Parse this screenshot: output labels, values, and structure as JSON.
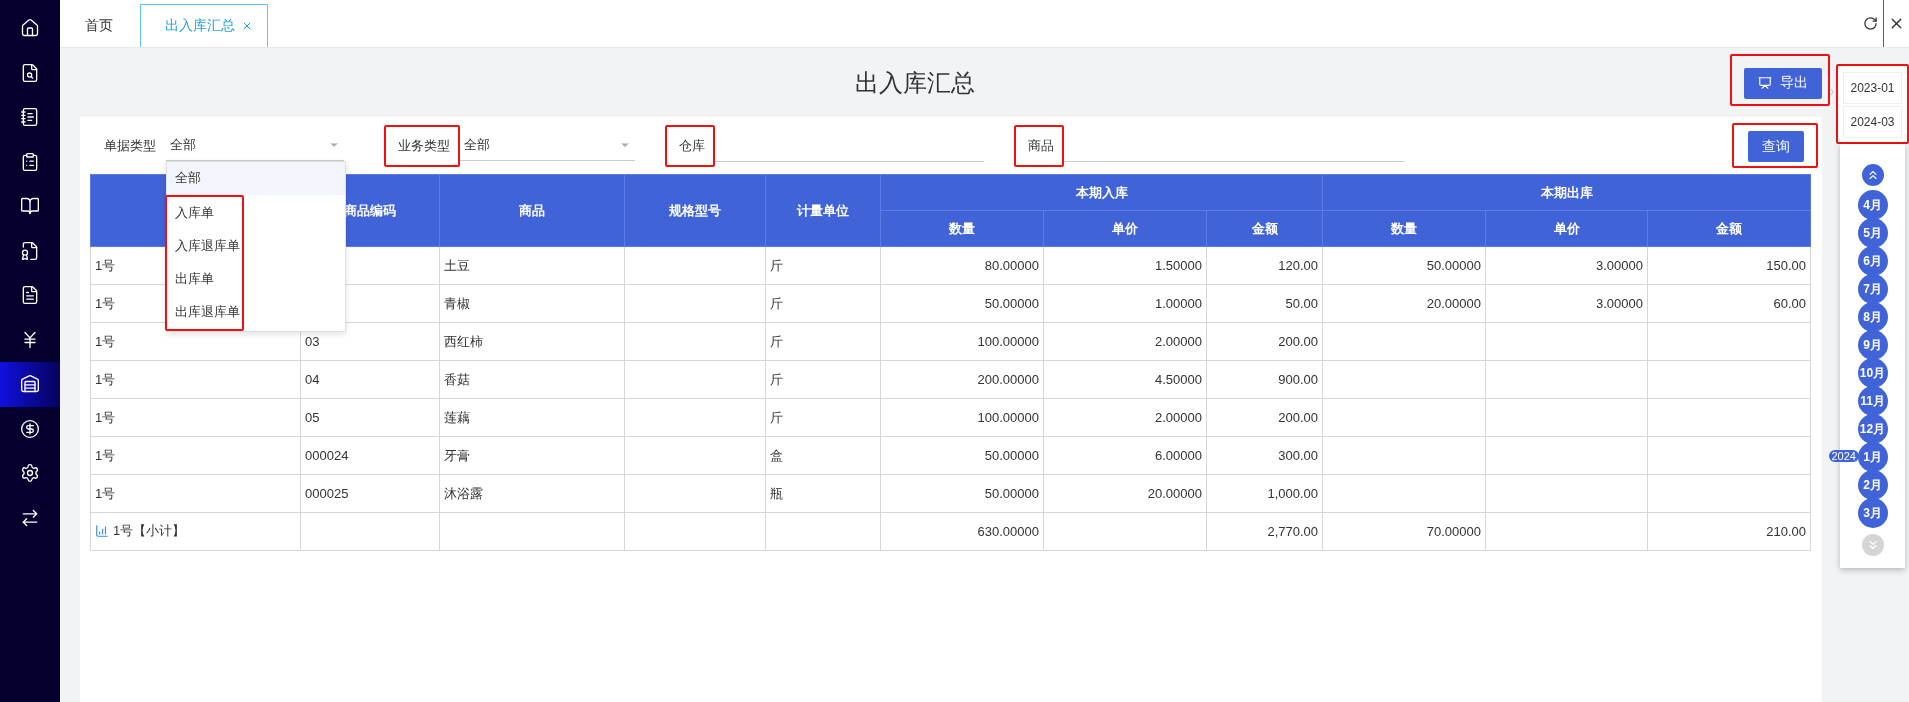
{
  "sidebar": {
    "items": [
      {
        "selected": false
      },
      {
        "selected": false
      },
      {
        "selected": false
      },
      {
        "selected": false
      },
      {
        "selected": false
      },
      {
        "selected": false
      },
      {
        "selected": false
      },
      {
        "selected": false
      },
      {
        "selected": true
      },
      {
        "selected": false
      },
      {
        "selected": false
      },
      {
        "selected": false
      }
    ]
  },
  "tabs": [
    {
      "label": "首页",
      "selected": false,
      "closable": false
    },
    {
      "label": "出入库汇总",
      "selected": true,
      "closable": true
    }
  ],
  "title": "出入库汇总",
  "export_button": {
    "label": "导出",
    "highlighted": true
  },
  "filters": [
    {
      "label": "单据类型",
      "kind": "select",
      "value": "全部",
      "highlighted": false,
      "options": [
        {
          "label": "全部",
          "selected": true,
          "highlighted": false
        },
        {
          "label": "入库单",
          "selected": false,
          "highlighted": true
        },
        {
          "label": "入库退库单",
          "selected": false,
          "highlighted": true
        },
        {
          "label": "出库单",
          "selected": false,
          "highlighted": true
        },
        {
          "label": "出库退库单",
          "selected": false,
          "highlighted": true
        }
      ]
    },
    {
      "label": "业务类型",
      "kind": "select",
      "value": "全部",
      "highlighted": true
    },
    {
      "label": "仓库",
      "kind": "text",
      "highlighted": true
    },
    {
      "label": "商品",
      "kind": "text",
      "highlighted": true
    }
  ],
  "query_button": {
    "label": "查询",
    "highlighted": true
  },
  "table": {
    "columns": [
      "",
      "商品编码",
      "商品",
      "规格型号",
      "计量单位"
    ],
    "header_groups": [
      {
        "label": "本期入库",
        "columns": [
          "数量",
          "单价",
          "金额"
        ]
      },
      {
        "label": "本期出库",
        "columns": [
          "数量",
          "单价",
          "金额"
        ]
      }
    ],
    "rows": [
      {
        "kind": "item",
        "cells": [
          "1号",
          null,
          "土豆",
          null,
          "斤",
          "80.00000",
          "1.50000",
          "120.00",
          "50.00000",
          "3.00000",
          "150.00"
        ]
      },
      {
        "kind": "item",
        "cells": [
          "1号",
          null,
          "青椒",
          null,
          "斤",
          "50.00000",
          "1.00000",
          "50.00",
          "20.00000",
          "3.00000",
          "60.00"
        ]
      },
      {
        "kind": "item",
        "cells": [
          "1号",
          "03",
          "西红柿",
          null,
          "斤",
          "100.00000",
          "2.00000",
          "200.00",
          null,
          null,
          null
        ]
      },
      {
        "kind": "item",
        "cells": [
          "1号",
          "04",
          "香菇",
          null,
          "斤",
          "200.00000",
          "4.50000",
          "900.00",
          null,
          null,
          null
        ]
      },
      {
        "kind": "item",
        "cells": [
          "1号",
          "05",
          "莲藕",
          null,
          "斤",
          "100.00000",
          "2.00000",
          "200.00",
          null,
          null,
          null
        ]
      },
      {
        "kind": "item",
        "cells": [
          "1号",
          "000024",
          "牙膏",
          null,
          "盒",
          "50.00000",
          "6.00000",
          "300.00",
          null,
          null,
          null
        ]
      },
      {
        "kind": "item",
        "cells": [
          "1号",
          "000025",
          "沐浴露",
          null,
          "瓶",
          "50.00000",
          "20.00000",
          "1,000.00",
          null,
          null,
          null
        ]
      },
      {
        "kind": "subtotal",
        "cells": [
          "1号【小计】",
          null,
          null,
          null,
          null,
          "630.00000",
          null,
          "2,770.00",
          "70.00000",
          null,
          "210.00"
        ]
      }
    ]
  },
  "period": {
    "start": "2023-01",
    "end": "2024-03",
    "highlighted": true,
    "months": [
      {
        "label": "4月"
      },
      {
        "label": "5月"
      },
      {
        "label": "6月"
      },
      {
        "label": "7月"
      },
      {
        "label": "8月"
      },
      {
        "label": "9月"
      },
      {
        "label": "10月"
      },
      {
        "label": "11月"
      },
      {
        "label": "12月"
      },
      {
        "label": "1月",
        "year": "2024"
      },
      {
        "label": "2月"
      },
      {
        "label": "3月"
      }
    ],
    "can_scroll_up": true,
    "can_scroll_down": false
  }
}
